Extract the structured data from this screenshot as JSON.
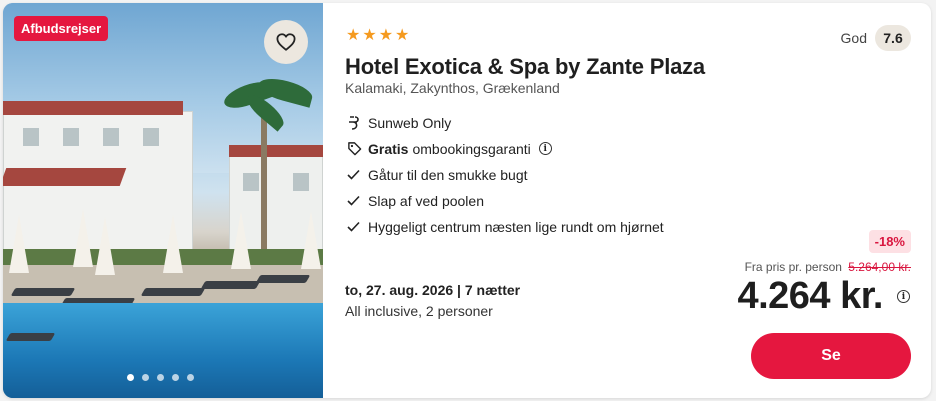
{
  "card": {
    "badge": "Afbudsrejser",
    "favorite_icon": "heart-outline-icon",
    "photo_count": 5,
    "active_photo": 1,
    "stars": 4,
    "title": "Hotel Exotica & Spa by Zante Plaza",
    "location": "Kalamaki, Zakynthos, Grækenland",
    "rating": {
      "word": "God",
      "score": "7.6"
    },
    "features": [
      {
        "icon": "sunweb-icon",
        "bold": "",
        "text": "Sunweb Only",
        "info": false
      },
      {
        "icon": "tag-icon",
        "bold": "Gratis",
        "text": "ombookingsgaranti",
        "info": true
      },
      {
        "icon": "check-icon",
        "bold": "",
        "text": "Gåtur til den smukke bugt",
        "info": false
      },
      {
        "icon": "check-icon",
        "bold": "",
        "text": "Slap af ved poolen",
        "info": false
      },
      {
        "icon": "check-icon",
        "bold": "",
        "text": "Hyggeligt centrum næsten lige rundt om hjørnet",
        "info": false
      }
    ],
    "dates": "to, 27. aug. 2026 | 7 nætter",
    "board": "All inclusive, 2 personer",
    "discount": "-18%",
    "from_label": "Fra pris pr. person",
    "old_price": "5.264,00 kr.",
    "price": "4.264 kr.",
    "cta_label": "Se"
  },
  "colors": {
    "brand_red": "#e5173f",
    "star": "#f59a1f",
    "chip_bg": "#ece7df"
  }
}
